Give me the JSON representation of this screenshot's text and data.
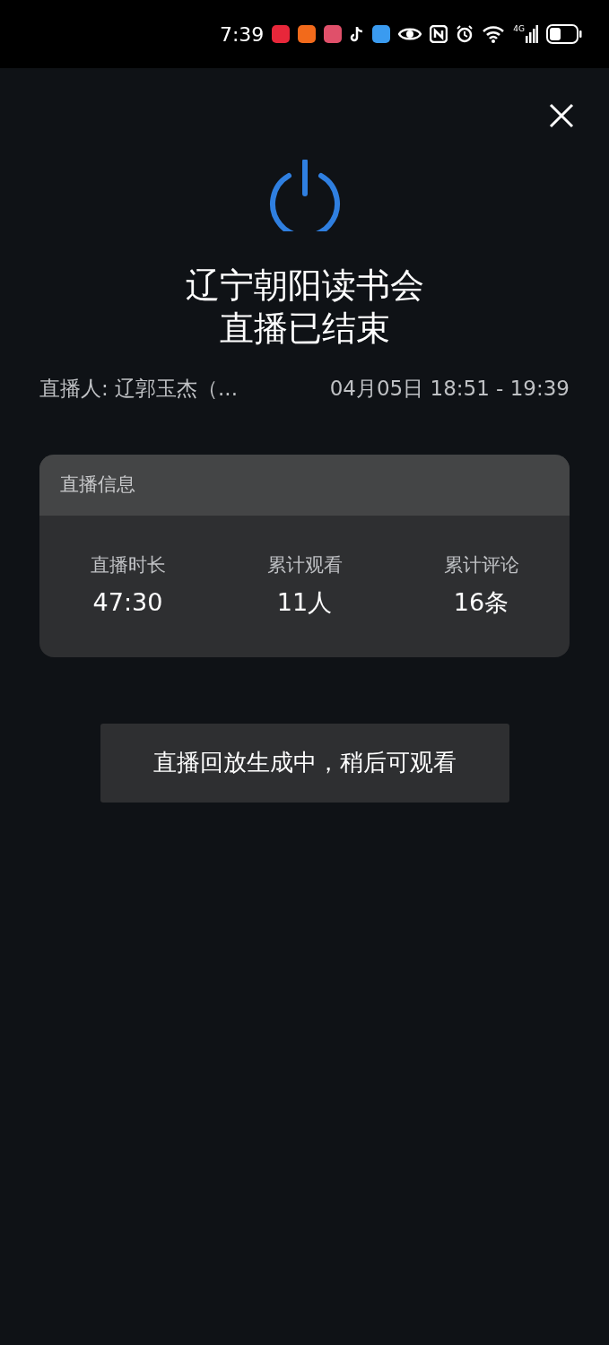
{
  "status_bar": {
    "time": "7:39",
    "network": "4G"
  },
  "title": "辽宁朝阳读书会",
  "subtitle": "直播已结束",
  "host": "直播人: 辽郭玉杰（...",
  "time_range": "04月05日 18:51 - 19:39",
  "info_card": {
    "title": "直播信息",
    "stats": [
      {
        "label": "直播时长",
        "value": "47:30"
      },
      {
        "label": "累计观看",
        "value": "11人"
      },
      {
        "label": "累计评论",
        "value": "16条"
      }
    ]
  },
  "notice": "直播回放生成中，稍后可观看"
}
